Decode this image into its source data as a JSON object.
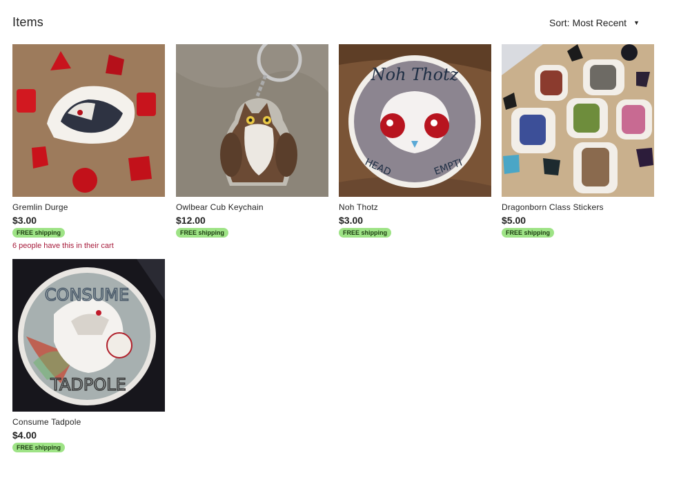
{
  "header": {
    "title": "Items"
  },
  "sort": {
    "label": "Sort: Most Recent"
  },
  "items": [
    {
      "name": "Gremlin Durge",
      "price": "$3.00",
      "badge": "FREE shipping",
      "note": "6 people have this in their cart"
    },
    {
      "name": "Owlbear Cub Keychain",
      "price": "$12.00",
      "badge": "FREE shipping"
    },
    {
      "name": "Noh Thotz",
      "price": "$3.00",
      "badge": "FREE shipping",
      "image_text": {
        "top": "Noh Thotz",
        "left": "HEAD",
        "right": "EMPTI"
      }
    },
    {
      "name": "Dragonborn Class Stickers",
      "price": "$5.00",
      "badge": "FREE shipping"
    },
    {
      "name": "Consume Tadpole",
      "price": "$4.00",
      "badge": "FREE shipping",
      "image_text": {
        "top": "CONSUME",
        "bottom": "TADPOLE"
      }
    }
  ],
  "colors": {
    "badge_bg": "#9ee386",
    "cart_note": "#a61a3a"
  }
}
